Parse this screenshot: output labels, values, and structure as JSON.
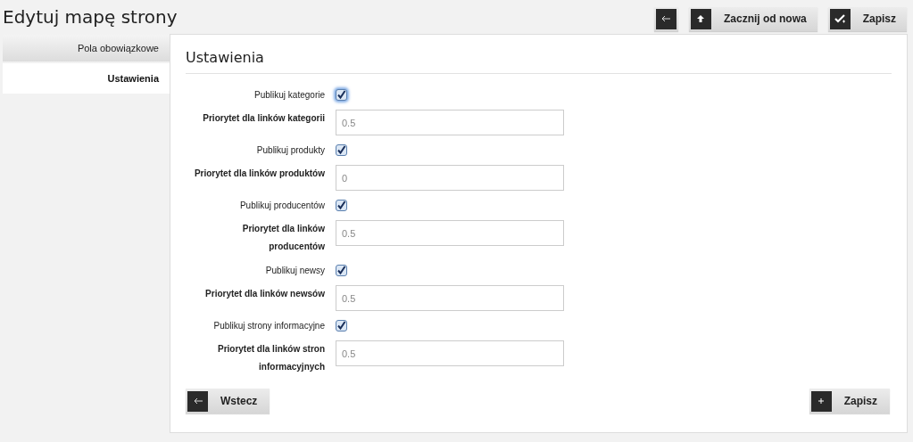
{
  "page_title": "Edytuj mapę strony",
  "toolbar": [
    {
      "kind": "back"
    },
    {
      "kind": "up",
      "label": "Zacznij od nowa"
    },
    {
      "kind": "save",
      "label": "Zapisz"
    }
  ],
  "sidebar": {
    "items": [
      {
        "label": "Pola obowiązkowe",
        "selected": false
      },
      {
        "label": "Ustawienia",
        "selected": true
      }
    ]
  },
  "section_title": "Ustawienia",
  "fields": [
    {
      "kind": "checkbox",
      "label": "Publikuj kategorie",
      "checked": true,
      "focused": true
    },
    {
      "kind": "text",
      "label": "Priorytet dla linków kategorii",
      "value": "0.5"
    },
    {
      "kind": "checkbox",
      "label": "Publikuj produkty",
      "checked": true
    },
    {
      "kind": "text",
      "label": "Priorytet dla linków produktów",
      "value": "0"
    },
    {
      "kind": "checkbox",
      "label": "Publikuj producentów",
      "checked": true
    },
    {
      "kind": "text",
      "label": "Priorytet dla linków producentów",
      "value": "0.5"
    },
    {
      "kind": "checkbox",
      "label": "Publikuj newsy",
      "checked": true
    },
    {
      "kind": "text",
      "label": "Priorytet dla linków newsów",
      "value": "0.5"
    },
    {
      "kind": "checkbox",
      "label": "Publikuj strony informacyjne",
      "checked": true
    },
    {
      "kind": "text",
      "label": "Priorytet dla linków stron informacyjnych",
      "value": "0.5"
    }
  ],
  "footer_buttons": [
    {
      "kind": "back",
      "label": "Wstecz"
    },
    {
      "kind": "add",
      "label": "Zapisz"
    }
  ]
}
